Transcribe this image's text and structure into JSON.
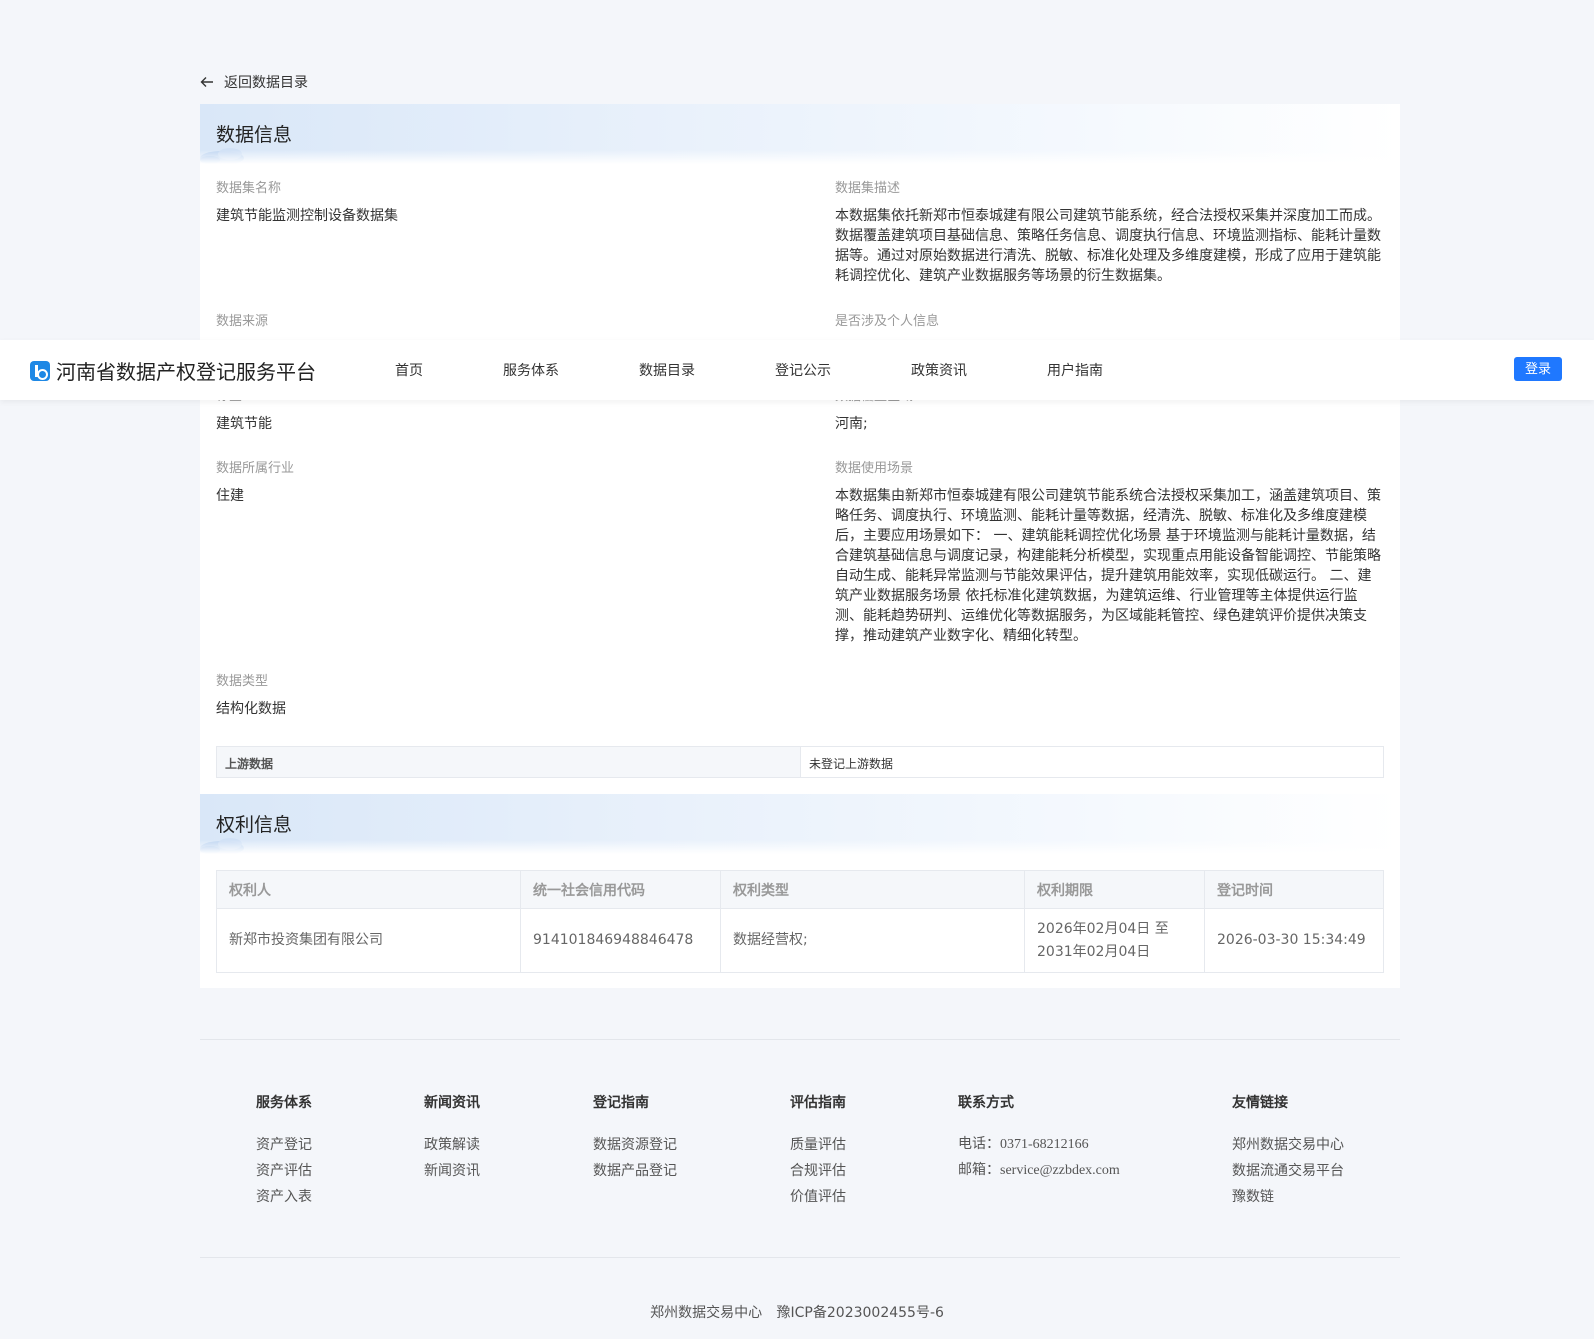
{
  "back_link": "返回数据目录",
  "nav": {
    "brand": "河南省数据产权登记服务平台",
    "items": [
      "首页",
      "服务体系",
      "数据目录",
      "登记公示",
      "政策资讯",
      "用户指南"
    ],
    "login": "登录"
  },
  "data_info": {
    "section_title": "数据信息",
    "dataset_name_label": "数据集名称",
    "dataset_name": "建筑节能监测控制设备数据集",
    "description_label": "数据集描述",
    "description": "本数据集依托新郑市恒泰城建有限公司建筑节能系统，经合法授权采集并深度加工而成。数据覆盖建筑项目基础信息、策略任务信息、调度执行信息、环境监测指标、能耗计量数据等。通过对原始数据进行清洗、脱敏、标准化处理及多维度建模，形成了应用于建筑能耗调控优化、建筑产业数据服务等场景的衍生数据集。",
    "source_label": "数据来源",
    "personal_info_label": "是否涉及个人信息",
    "tag_label": "标签",
    "tag": "建筑节能",
    "coverage_label": "数据覆盖区域",
    "coverage": "河南;",
    "industry_label": "数据所属行业",
    "industry": "住建",
    "scenario_label": "数据使用场景",
    "scenario": "本数据集由新郑市恒泰城建有限公司建筑节能系统合法授权采集加工，涵盖建筑项目、策略任务、调度执行、环境监测、能耗计量等数据，经清洗、脱敏、标准化及多维度建模后，主要应用场景如下： 一、建筑能耗调控优化场景 基于环境监测与能耗计量数据，结合建筑基础信息与调度记录，构建能耗分析模型，实现重点用能设备智能调控、节能策略自动生成、能耗异常监测与节能效果评估，提升建筑用能效率，实现低碳运行。 二、建筑产业数据服务场景 依托标准化建筑数据，为建筑运维、行业管理等主体提供运行监测、能耗趋势研判、运维优化等数据服务，为区域能耗管控、绿色建筑评价提供决策支撑，推动建筑产业数字化、精细化转型。",
    "type_label": "数据类型",
    "type": "结构化数据",
    "upstream_label": "上游数据",
    "upstream": "未登记上游数据"
  },
  "rights_info": {
    "section_title": "权利信息",
    "headers": [
      "权利人",
      "统一社会信用代码",
      "权利类型",
      "权利期限",
      "登记时间"
    ],
    "row": {
      "holder": "新郑市投资集团有限公司",
      "credit_code": "914101846948846478",
      "rights_type": "数据经营权;",
      "period_start": "2026年02月04日 至",
      "period_end": "2031年02月04日",
      "registered_at": "2026-03-30 15:34:49"
    }
  },
  "footer": {
    "columns": [
      {
        "title": "服务体系",
        "items": [
          "资产登记",
          "资产评估",
          "资产入表"
        ]
      },
      {
        "title": "新闻资讯",
        "items": [
          "政策解读",
          "新闻资讯"
        ]
      },
      {
        "title": "登记指南",
        "items": [
          "数据资源登记",
          "数据产品登记"
        ]
      },
      {
        "title": "评估指南",
        "items": [
          "质量评估",
          "合规评估",
          "价值评估"
        ]
      },
      {
        "title": "联系方式",
        "items": [
          "电话：0371-68212166",
          "邮箱：service@zzbdex.com"
        ]
      },
      {
        "title": "友情链接",
        "items": [
          "郑州数据交易中心",
          "数据流通交易平台",
          "豫数链"
        ]
      }
    ],
    "copyright_org": "郑州数据交易中心",
    "icp": "豫ICP备2023002455号-6"
  },
  "colors": {
    "primary": "#1f78ff",
    "page_bg": "#f4f6fa",
    "section_head": "#d9e7f8"
  }
}
